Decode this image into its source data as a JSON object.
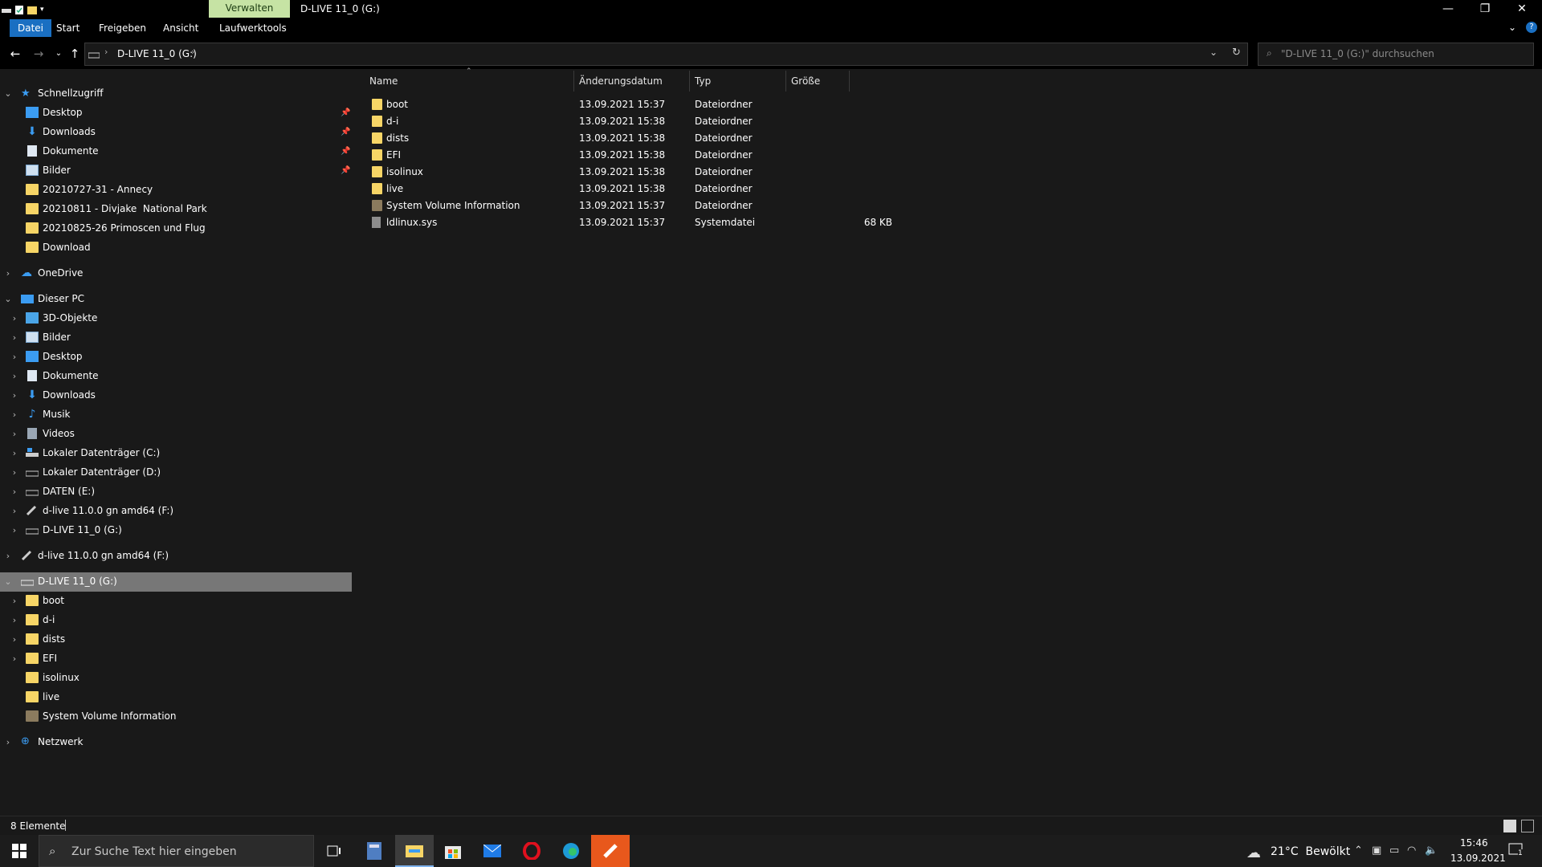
{
  "titlebar": {
    "context_tab": "Verwalten",
    "window_title": "D-LIVE 11_0 (G:)",
    "minimize": "—",
    "restore": "❐",
    "close": "✕"
  },
  "ribbon": {
    "tabs": [
      "Datei",
      "Start",
      "Freigeben",
      "Ansicht",
      "Laufwerktools"
    ],
    "help": "?"
  },
  "address": {
    "path_label": "D-LIVE 11_0 (G:)",
    "search_placeholder": "\"D-LIVE 11_0 (G:)\" durchsuchen"
  },
  "sidebar": {
    "quick_access": {
      "label": "Schnellzugriff",
      "items": [
        "Desktop",
        "Downloads",
        "Dokumente",
        "Bilder",
        "20210727-31 - Annecy",
        "20210811 - Divjake  National Park",
        "20210825-26 Primoscen und Flug",
        "Download"
      ]
    },
    "onedrive": "OneDrive",
    "this_pc": {
      "label": "Dieser PC",
      "items": [
        "3D-Objekte",
        "Bilder",
        "Desktop",
        "Dokumente",
        "Downloads",
        "Musik",
        "Videos",
        "Lokaler Datenträger (C:)",
        "Lokaler Datenträger (D:)",
        "DATEN (E:)",
        "d-live 11.0.0 gn amd64 (F:)",
        "D-LIVE 11_0 (G:)"
      ]
    },
    "removable_f": "d-live 11.0.0 gn amd64 (F:)",
    "removable_g": {
      "label": "D-LIVE 11_0 (G:)",
      "items": [
        "boot",
        "d-i",
        "dists",
        "EFI",
        "isolinux",
        "live",
        "System Volume Information"
      ]
    },
    "network": "Netzwerk"
  },
  "columns": {
    "name": "Name",
    "date": "Änderungsdatum",
    "type": "Typ",
    "size": "Größe"
  },
  "files": [
    {
      "name": "boot",
      "date": "13.09.2021 15:37",
      "type": "Dateiordner",
      "size": ""
    },
    {
      "name": "d-i",
      "date": "13.09.2021 15:38",
      "type": "Dateiordner",
      "size": ""
    },
    {
      "name": "dists",
      "date": "13.09.2021 15:38",
      "type": "Dateiordner",
      "size": ""
    },
    {
      "name": "EFI",
      "date": "13.09.2021 15:38",
      "type": "Dateiordner",
      "size": ""
    },
    {
      "name": "isolinux",
      "date": "13.09.2021 15:38",
      "type": "Dateiordner",
      "size": ""
    },
    {
      "name": "live",
      "date": "13.09.2021 15:38",
      "type": "Dateiordner",
      "size": ""
    },
    {
      "name": "System Volume Information",
      "date": "13.09.2021 15:37",
      "type": "Dateiordner",
      "size": ""
    },
    {
      "name": "ldlinux.sys",
      "date": "13.09.2021 15:37",
      "type": "Systemdatei",
      "size": "68 KB"
    }
  ],
  "status": {
    "item_count": "8 Elemente"
  },
  "taskbar": {
    "search_placeholder": "Zur Suche Text hier eingeben",
    "weather": "21°C  Bewölkt",
    "time": "15:46",
    "date": "13.09.2021",
    "notification_count": "1"
  },
  "colors": {
    "background": "#191919",
    "selected_row": "#777777",
    "folder": "#f7d566",
    "accent_tab": "#1a6fc2",
    "context_tab": "#c6e3a4"
  }
}
